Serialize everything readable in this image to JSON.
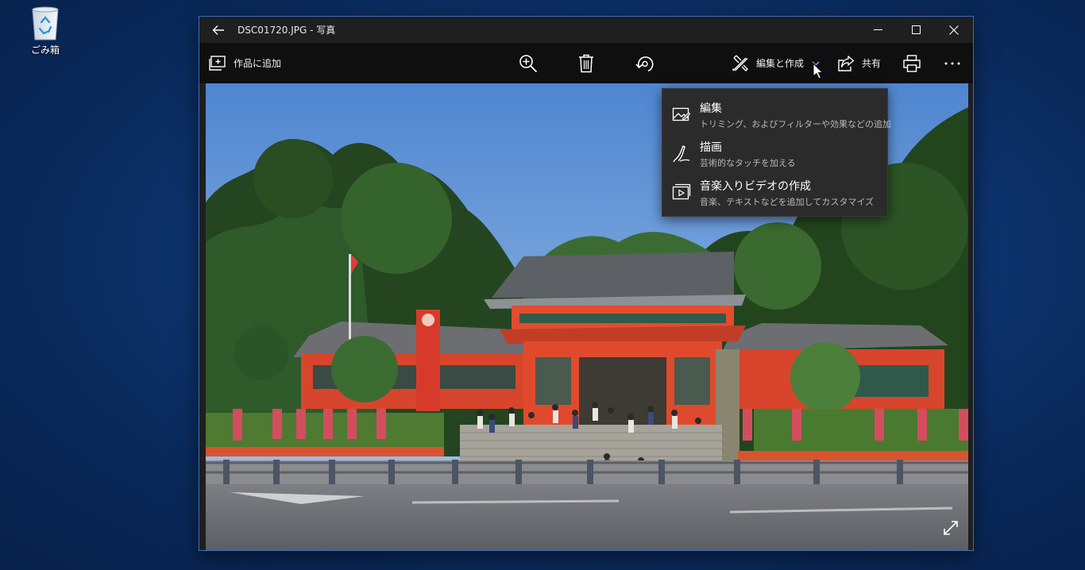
{
  "desktop": {
    "recycle_bin_label": "ごみ箱"
  },
  "window": {
    "title": "DSC01720.JPG - 写真"
  },
  "toolbar": {
    "add_to_album_label": "作品に追加",
    "edit_create_label": "編集と作成",
    "share_label": "共有"
  },
  "dropdown": {
    "items": [
      {
        "title": "編集",
        "desc": "トリミング、およびフィルターや効果などの追加",
        "icon": "photo-edit-icon"
      },
      {
        "title": "描画",
        "desc": "芸術的なタッチを加える",
        "icon": "pen-icon"
      },
      {
        "title": "音楽入りビデオの作成",
        "desc": "音楽、テキストなどを追加してカスタマイズ",
        "icon": "video-icon"
      }
    ]
  },
  "icons": [
    "recycle-bin-icon",
    "back-arrow-icon",
    "minimize-icon",
    "maximize-icon",
    "close-icon",
    "add-to-album-icon",
    "zoom-in-icon",
    "trash-icon",
    "rotate-icon",
    "edit-create-icon",
    "chevron-down-icon",
    "share-icon",
    "print-icon",
    "more-icon",
    "fullscreen-icon"
  ],
  "colors": {
    "accent": "#3d6fb6",
    "chevron": "#4fa3f7",
    "toolbar_bg": "#0f0f0f",
    "menu_bg": "#2b2b2b"
  }
}
